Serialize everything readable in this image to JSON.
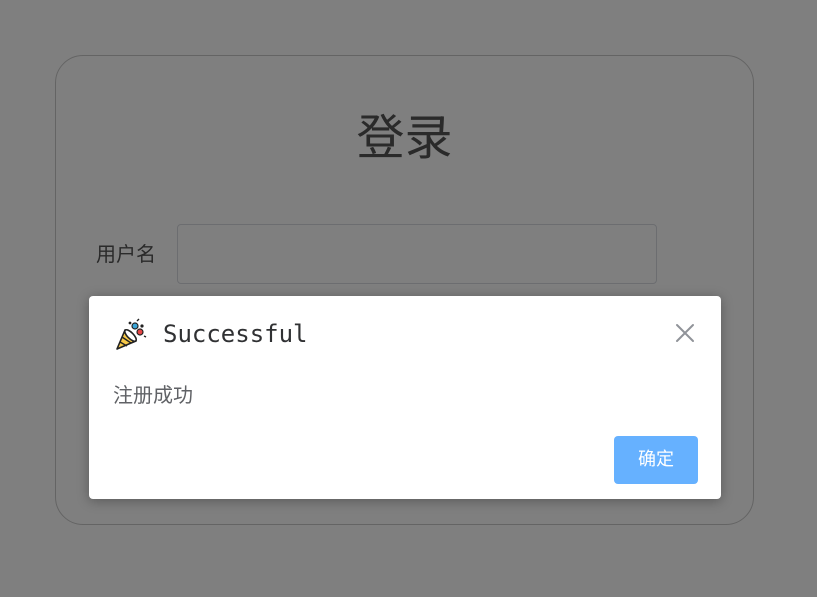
{
  "login": {
    "title": "登录",
    "username_label": "用户名",
    "username_value": ""
  },
  "dialog": {
    "icon": "party-popper-icon",
    "title": "Successful",
    "message": "注册成功",
    "confirm_label": "确定",
    "close_icon": "close-icon"
  },
  "colors": {
    "overlay": "rgba(0,0,0,0.5)",
    "confirm_button": "#66b1ff",
    "card_border": "#c9c9c9"
  }
}
